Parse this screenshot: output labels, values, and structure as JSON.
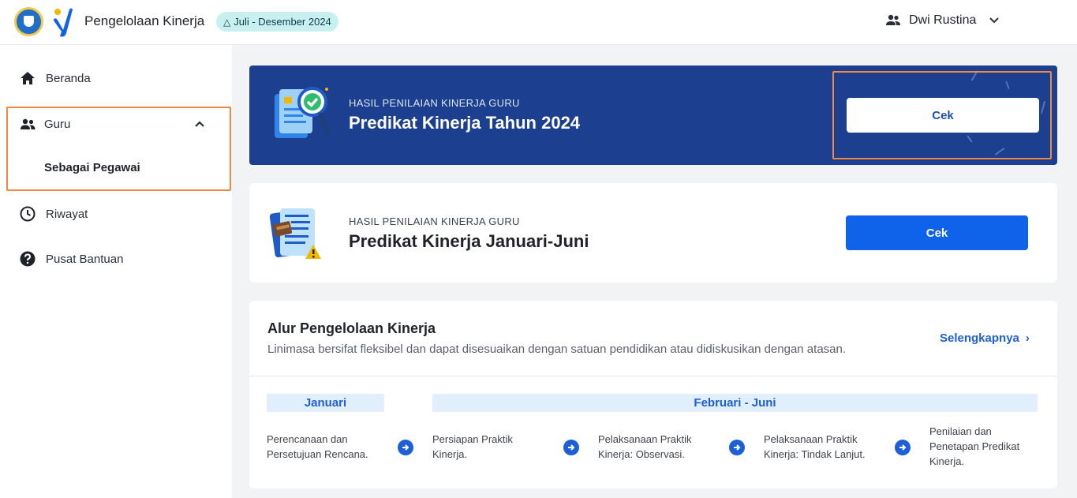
{
  "header": {
    "app_title": "Pengelolaan Kinerja",
    "period_badge": "Juli - Desember 2024",
    "user_name": "Dwi Rustina"
  },
  "sidebar": {
    "items": [
      {
        "label": "Beranda",
        "icon": "home-icon"
      },
      {
        "label": "Guru",
        "icon": "users-icon"
      },
      {
        "label": "Riwayat",
        "icon": "clock-icon"
      },
      {
        "label": "Pusat Bantuan",
        "icon": "help-icon"
      }
    ],
    "guru_sub": "Sebagai Pegawai"
  },
  "banner": {
    "kicker": "HASIL PENILAIAN KINERJA GURU",
    "title": "Predikat Kinerja Tahun 2024",
    "button": "Cek"
  },
  "card_semester": {
    "kicker": "HASIL PENILAIAN KINERJA GURU",
    "title": "Predikat Kinerja Januari-Juni",
    "button": "Cek"
  },
  "alur": {
    "title": "Alur Pengelolaan Kinerja",
    "description": "Linimasa bersifat fleksibel dan dapat disesuaikan dengan satuan pendidikan atau didiskusikan dengan atasan.",
    "more_link": "Selengkapnya",
    "phases": [
      "Januari",
      "Februari - Juni"
    ],
    "steps": [
      {
        "line1": "Perencanaan dan",
        "line2": "Persetujuan Rencana.",
        "line3": ""
      },
      {
        "line1": "Persiapan Praktik",
        "line2": "Kinerja.",
        "line3": ""
      },
      {
        "line1": "Pelaksanaan Praktik",
        "line2": "Kinerja: Observasi.",
        "line3": ""
      },
      {
        "line1": "Pelaksanaan Praktik",
        "line2": "Kinerja: Tindak Lanjut.",
        "line3": ""
      },
      {
        "line1": "Penilaian dan",
        "line2": "Penetapan Predikat",
        "line3": "Kinerja."
      }
    ]
  },
  "colors": {
    "banner_bg": "#1c3f8f",
    "primary_blue": "#0e63ea",
    "highlight_orange": "#f0883e",
    "badge_bg": "#c8f0f0"
  }
}
